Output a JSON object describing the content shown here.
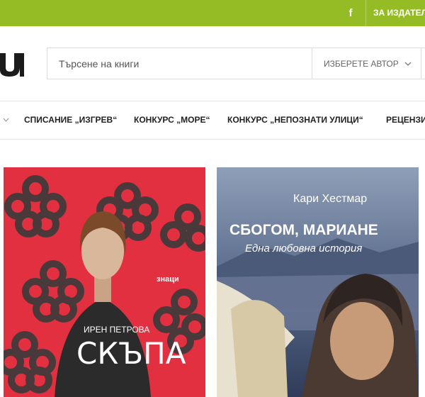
{
  "topbar": {
    "facebook_icon": "facebook-icon",
    "publishers_label": "ЗА ИЗДАТЕЛ"
  },
  "header": {
    "logo_text": "u",
    "search_placeholder": "Търсене на книги",
    "author_select": "ИЗБЕРЕТЕ АВТОР"
  },
  "nav": {
    "items": [
      "СПИСАНИЕ „ИЗГРЕВ“",
      "КОНКУРС „МОРЕ“",
      "КОНКУРС „НЕПОЗНАТИ УЛИЦИ“",
      "РЕЦЕНЗИ"
    ]
  },
  "books": [
    {
      "publisher": "знаци",
      "author": "ИРЕН ПЕТРОВА",
      "title": "СКЪПА",
      "background": "#e23040"
    },
    {
      "author": "Кари Хестмар",
      "title": "СБОГОМ, МАРИАНЕ",
      "subtitle": "Една любовна история",
      "background": "#3b4f78"
    }
  ],
  "colors": {
    "accent": "#95bb25"
  }
}
